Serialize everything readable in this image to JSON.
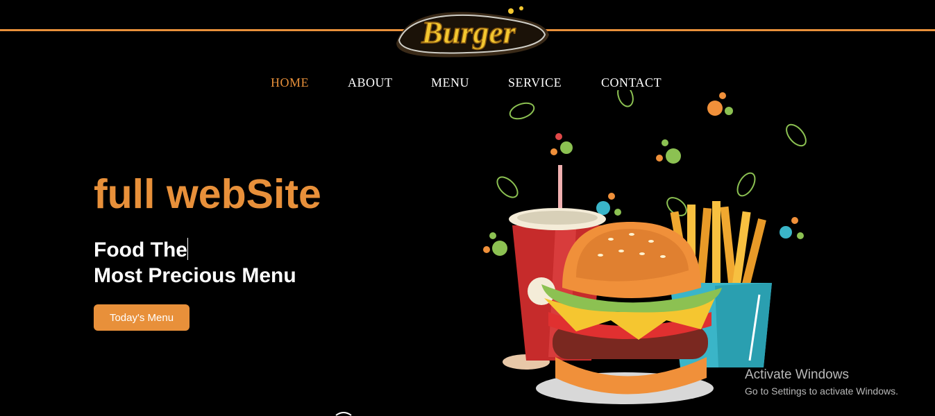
{
  "brand": {
    "logo_text": "Burger"
  },
  "nav": {
    "items": [
      {
        "label": "HOME",
        "active": true
      },
      {
        "label": "ABOUT",
        "active": false
      },
      {
        "label": "MENU",
        "active": false
      },
      {
        "label": "SERVICE",
        "active": false
      },
      {
        "label": "CONTACT",
        "active": false
      }
    ]
  },
  "hero": {
    "title": "full webSite",
    "subtitle_line1": "Food The",
    "subtitle_line2": "Most Precious Menu",
    "button_label": "Today's Menu"
  },
  "illustration": {
    "icon_names": [
      "drink-cup-icon",
      "burger-icon",
      "fries-icon",
      "leaf-icon"
    ]
  },
  "system": {
    "activate_title": "Activate Windows",
    "activate_hint": "Go to Settings to activate Windows."
  },
  "colors": {
    "accent": "#e8903a",
    "background": "#000000",
    "text": "#ffffff"
  }
}
